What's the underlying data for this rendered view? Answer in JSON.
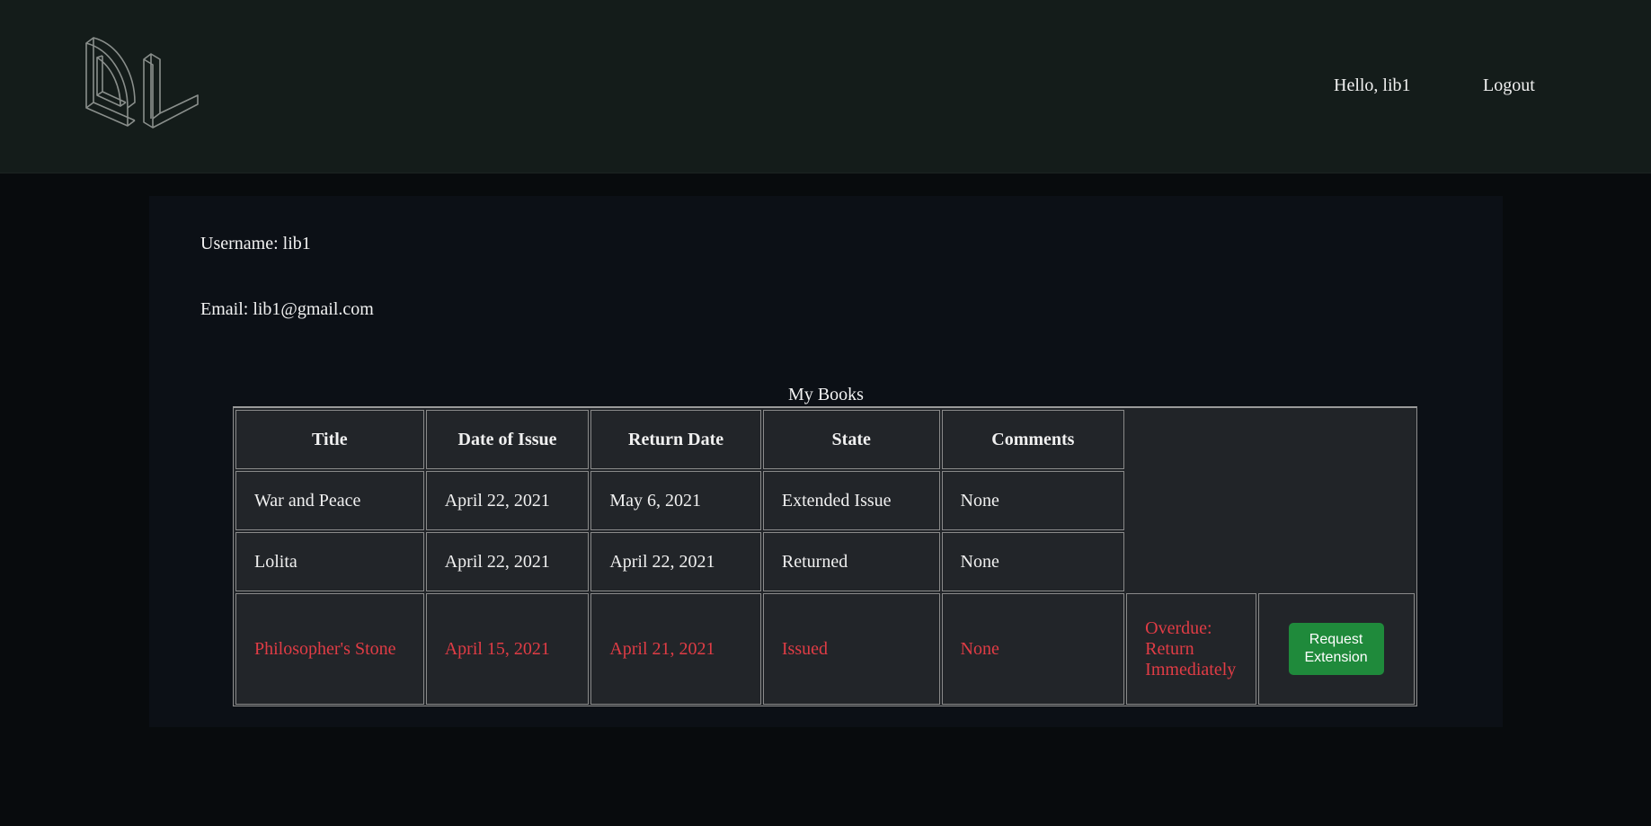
{
  "header": {
    "logo_icon": "dl-logo-icon",
    "greeting": "Hello, lib1",
    "logout": "Logout"
  },
  "profile": {
    "username": "Username: lib1",
    "email": "Email: lib1@gmail.com"
  },
  "books": {
    "caption": "My Books",
    "columns": [
      "Title",
      "Date of Issue",
      "Return Date",
      "State",
      "Comments"
    ],
    "rows": [
      {
        "title": "War and Peace",
        "issued": "April 22, 2021",
        "return": "May 6, 2021",
        "state": "Extended Issue",
        "comments": "None"
      },
      {
        "title": "Lolita",
        "issued": "April 22, 2021",
        "return": "April 22, 2021",
        "state": "Returned",
        "comments": "None"
      },
      {
        "title": "Philosopher's Stone",
        "issued": "April 15, 2021",
        "return": "April 21, 2021",
        "state": "Issued",
        "comments": "None",
        "status": "Overdue: Return Immediately",
        "action": "Request Extension"
      }
    ]
  },
  "colors": {
    "header_bg": "#141c1a",
    "page_bg": "#080b0d",
    "panel_bg": "#0c1016",
    "table_bg": "#222529",
    "overdue": "#e03c45",
    "button": "#1f8a3b"
  }
}
